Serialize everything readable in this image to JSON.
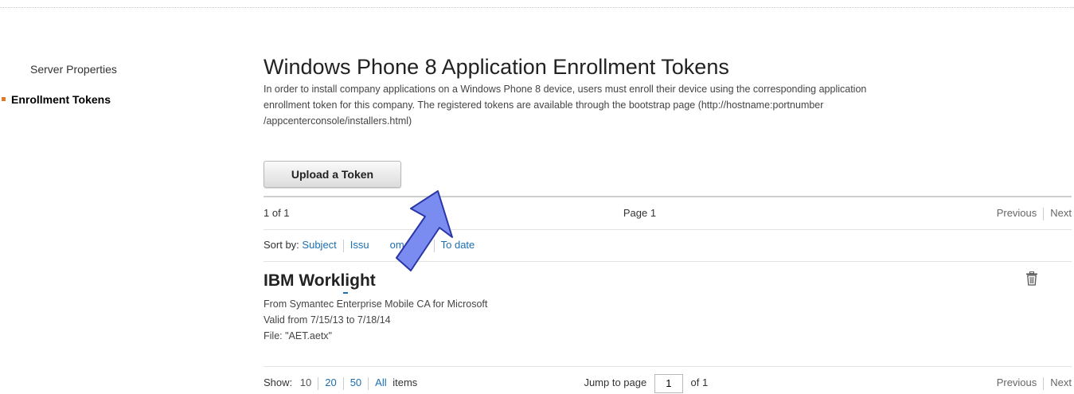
{
  "sidebar": {
    "items": [
      {
        "label": "Server Properties",
        "active": false
      },
      {
        "label": "Enrollment Tokens",
        "active": true
      }
    ]
  },
  "main": {
    "title": "Windows Phone 8 Application Enrollment Tokens",
    "description_lines": [
      "In order to install company applications on a Windows Phone 8 device, users must enroll their device using the corresponding application",
      "enrollment token for this company. The registered tokens are available through the bootstrap page (http://hostname:portnumber",
      "/appcenterconsole/installers.html)"
    ],
    "upload_label": "Upload a Token"
  },
  "pager_top": {
    "count": "1 of 1",
    "page": "Page 1",
    "previous": "Previous",
    "next": "Next"
  },
  "sort": {
    "label": "Sort by:",
    "options": [
      "Subject",
      "Issuer",
      "From date",
      "To date"
    ],
    "visible_fragments": [
      "Issu",
      "om date"
    ]
  },
  "token": {
    "title": "IBM Worklight",
    "from": "From Symantec Enterprise Mobile CA for Microsoft",
    "valid": "Valid from 7/15/13 to 7/18/14",
    "file": "File: \"AET.aetx\""
  },
  "pager_bottom": {
    "show_label": "Show:",
    "sizes": [
      "10",
      "20",
      "50",
      "All"
    ],
    "items_label": "items",
    "jump_label": "Jump to page",
    "jump_value": "1",
    "of_label": "of 1",
    "previous": "Previous",
    "next": "Next"
  },
  "colors": {
    "accent_bullet": "#e07a28",
    "link": "#1a6fb3",
    "arrow_fill": "#7b8cf0",
    "arrow_stroke": "#2a36a8"
  },
  "icons": {
    "delete": "trash-icon",
    "overlay": "arrow-pointer-icon"
  }
}
